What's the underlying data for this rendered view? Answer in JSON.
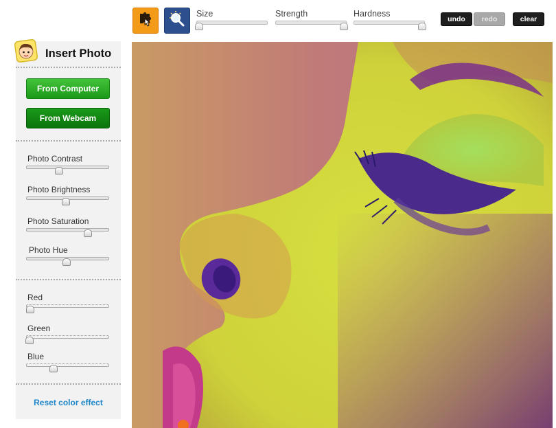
{
  "toolbar": {
    "tools": [
      {
        "name": "brush",
        "icon": "puzzle-hand-icon",
        "active": true
      },
      {
        "name": "zoom",
        "icon": "magnifier-icon",
        "active": false
      }
    ],
    "sliders": [
      {
        "label": "Size",
        "value": 0.02
      },
      {
        "label": "Strength",
        "value": 0.98
      },
      {
        "label": "Hardness",
        "value": 0.98
      }
    ],
    "undo_label": "undo",
    "redo_label": "redo",
    "clear_label": "clear"
  },
  "sidebar": {
    "title": "Insert Photo",
    "from_computer_label": "From Computer",
    "from_webcam_label": "From Webcam",
    "adjustments": [
      {
        "label": "Photo Contrast",
        "value": 0.4
      },
      {
        "label": "Photo Brightness",
        "value": 0.48
      },
      {
        "label": "Photo Saturation",
        "value": 0.74
      },
      {
        "label": "Photo Hue",
        "value": 0.49
      }
    ],
    "color_channels": [
      {
        "label": "Red",
        "value": 0.05
      },
      {
        "label": "Green",
        "value": 0.0
      },
      {
        "label": "Blue",
        "value": 0.33
      }
    ],
    "reset_label": "Reset color effect"
  },
  "colors": {
    "brush_button": "#f39a17",
    "zoom_button": "#2d4f8e",
    "green_button": "#1b9a19",
    "link": "#1f86c8"
  }
}
